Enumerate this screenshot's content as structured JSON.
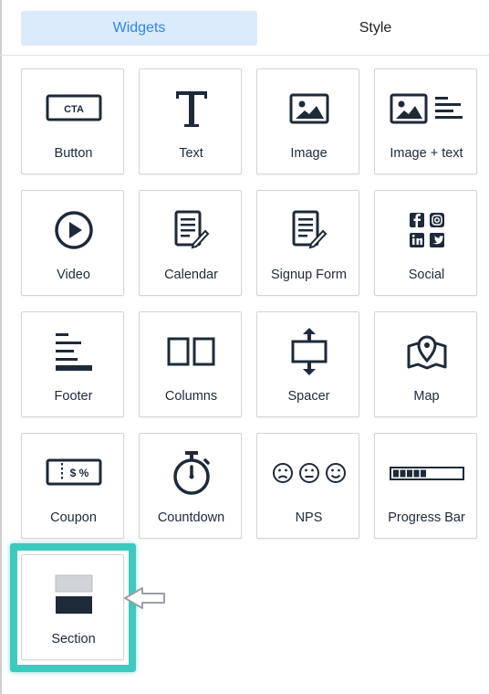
{
  "tabs": {
    "widgets": "Widgets",
    "style": "Style"
  },
  "accent_color": "#2e86e6",
  "highlight_color": "#3ec9bf",
  "widgets": [
    {
      "label": "Button",
      "icon": "cta-button-icon",
      "icon_text": "CTA"
    },
    {
      "label": "Text",
      "icon": "text-t-icon"
    },
    {
      "label": "Image",
      "icon": "image-icon"
    },
    {
      "label": "Image + text",
      "icon": "image-text-icon"
    },
    {
      "label": "Video",
      "icon": "play-icon"
    },
    {
      "label": "Calendar",
      "icon": "calendar-document-icon"
    },
    {
      "label": "Signup Form",
      "icon": "signup-form-icon"
    },
    {
      "label": "Social",
      "icon": "social-icons-grid"
    },
    {
      "label": "Footer",
      "icon": "footer-lines-icon"
    },
    {
      "label": "Columns",
      "icon": "columns-icon"
    },
    {
      "label": "Spacer",
      "icon": "spacer-icon"
    },
    {
      "label": "Map",
      "icon": "map-icon"
    },
    {
      "label": "Coupon",
      "icon": "coupon-icon",
      "icon_text": "$ %"
    },
    {
      "label": "Countdown",
      "icon": "stopwatch-icon"
    },
    {
      "label": "NPS",
      "icon": "nps-faces-icon"
    },
    {
      "label": "Progress Bar",
      "icon": "progress-bar-icon",
      "progress": 0.5
    },
    {
      "label": "Section",
      "icon": "section-icon"
    }
  ]
}
